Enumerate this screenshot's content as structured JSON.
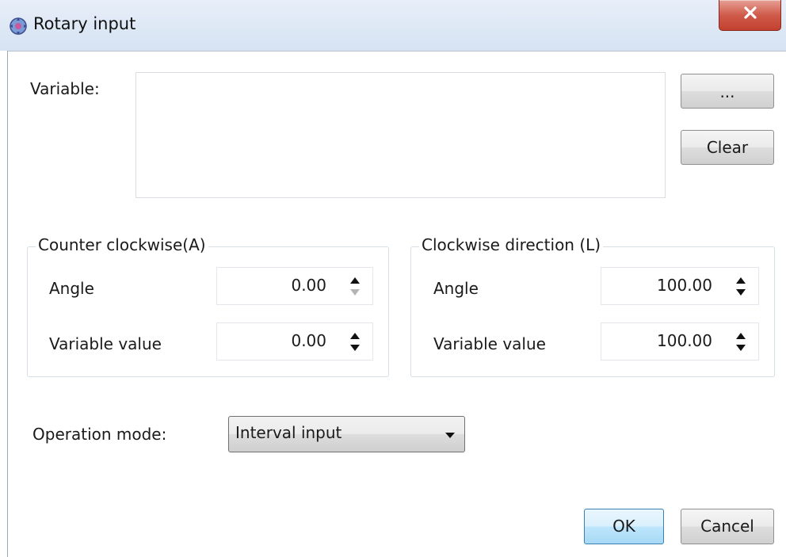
{
  "window": {
    "title": "Rotary input",
    "icon": "rotary-app-icon",
    "close_icon": "close-x-icon"
  },
  "variable": {
    "label": "Variable:",
    "value": "",
    "browse_label": "...",
    "clear_label": "Clear"
  },
  "counter_clockwise": {
    "legend": "Counter clockwise(A)",
    "angle_label": "Angle",
    "angle_value": "0.00",
    "varval_label": "Variable value",
    "varval_value": "0.00"
  },
  "clockwise": {
    "legend": "Clockwise direction (L)",
    "angle_label": "Angle",
    "angle_value": "100.00",
    "varval_label": "Variable value",
    "varval_value": "100.00"
  },
  "operation_mode": {
    "label": "Operation mode:",
    "selected": "Interval input"
  },
  "footer": {
    "ok_label": "OK",
    "cancel_label": "Cancel"
  },
  "colors": {
    "titlebar": "#dbe6f4",
    "close_button": "#c84a3a",
    "ok_accent": "#3c7fb1"
  }
}
